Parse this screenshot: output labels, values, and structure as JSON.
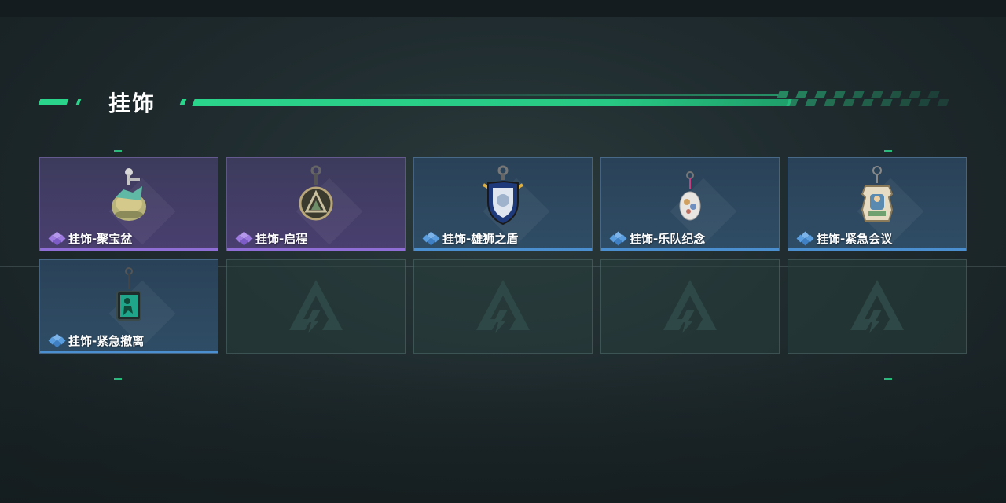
{
  "section": {
    "title": "挂饰"
  },
  "colors": {
    "accent": "#2bd48b",
    "rarity_purple": "#8f6fd6",
    "rarity_blue": "#4b8fd0"
  },
  "items": [
    {
      "label": "挂饰-聚宝盆",
      "rarity": "purple",
      "icon": "treasure-bowl-charm-icon"
    },
    {
      "label": "挂饰-启程",
      "rarity": "purple",
      "icon": "departure-charm-icon"
    },
    {
      "label": "挂饰-雄狮之盾",
      "rarity": "blue",
      "icon": "lion-shield-charm-icon"
    },
    {
      "label": "挂饰-乐队纪念",
      "rarity": "blue",
      "icon": "band-memorial-charm-icon"
    },
    {
      "label": "挂饰-紧急会议",
      "rarity": "blue",
      "icon": "emergency-meeting-charm-icon"
    },
    {
      "label": "挂饰-紧急撤离",
      "rarity": "blue",
      "icon": "emergency-evacuation-charm-icon"
    }
  ],
  "empty_slots": 4,
  "empty_icon": "placeholder-logo-icon"
}
